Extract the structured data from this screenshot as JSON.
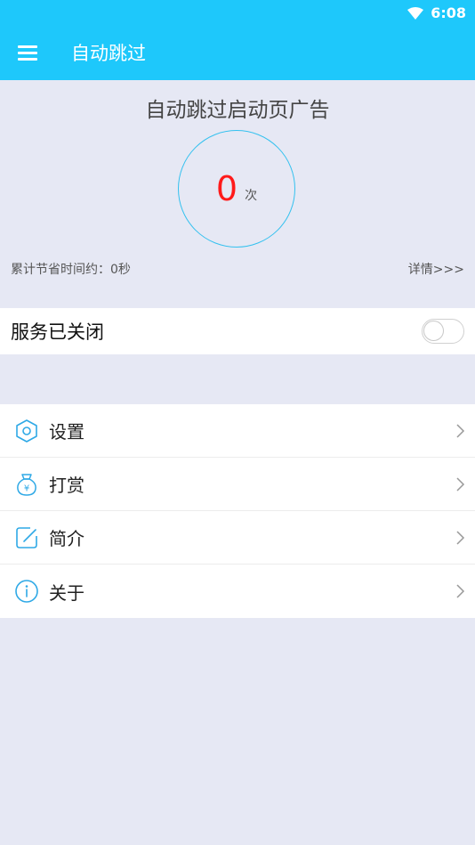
{
  "status_bar": {
    "time": "6:08"
  },
  "app_bar": {
    "title": "自动跳过"
  },
  "hero": {
    "title": "自动跳过启动页广告",
    "count": "0",
    "count_unit": "次",
    "saved_time": "累计节省时间约：0秒",
    "details_link": "详情>>>"
  },
  "service": {
    "label": "服务已关闭",
    "enabled": false
  },
  "menu": {
    "items": [
      {
        "label": "设置",
        "icon": "hexagon-settings-icon"
      },
      {
        "label": "打赏",
        "icon": "money-bag-icon"
      },
      {
        "label": "简介",
        "icon": "edit-icon"
      },
      {
        "label": "关于",
        "icon": "info-icon"
      }
    ]
  },
  "colors": {
    "accent": "#1ec8fb",
    "icon_blue": "#2fa9e6",
    "count_red": "#ff1a1a",
    "background": "#e6e8f4"
  }
}
